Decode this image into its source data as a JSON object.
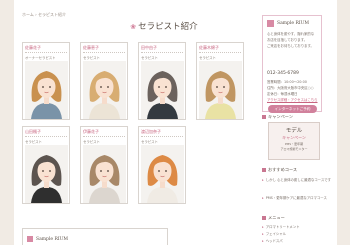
{
  "breadcrumb": "ホーム › セラピスト紹介",
  "page_title": "セラピスト紹介",
  "therapists": [
    {
      "name": "佐藤花子",
      "role": "オーナーセラピスト"
    },
    {
      "name": "佐藤恵子",
      "role": "セラピスト"
    },
    {
      "name": "田中由子",
      "role": "セラピスト"
    },
    {
      "name": "佐藤木綿子",
      "role": "セラピスト"
    },
    {
      "name": "山田楓子",
      "role": "セラピスト"
    },
    {
      "name": "伊藤花子",
      "role": "セラピスト"
    },
    {
      "name": "渡辺加奈子",
      "role": "セラピスト"
    }
  ],
  "sidebar": {
    "salon_name": "Sample RIUM",
    "lines": [
      "心と身体を癒やす、隠れ家的な",
      "お店を目指しております。",
      "ご来店をお待ちしております。"
    ],
    "tel": "012-345-6789",
    "info": [
      "営業時間：10:00〜20:00",
      "住所：大阪府大阪市中央区○○",
      "定休日：毎週水曜日",
      "アクセス詳細・アクセスはこちら"
    ],
    "reserve_button": "インターネットご予約",
    "campaign_heading": "キャンペーン",
    "model_banner": {
      "title": "モデル",
      "subtitle": "キャンペーン",
      "line1": "PMS・更年期",
      "line2": "アロマ施術モニター"
    },
    "course_heading": "おすすめコース",
    "courses": [
      "しかし 心と身体の癒しに最適なコースです",
      "PMS・更年期ケアに最適なアロマコース"
    ],
    "menu_heading": "メニュー",
    "menu": [
      "アロマトリートメント",
      "フェイシャル",
      "ヘッドスパ"
    ]
  },
  "footer": {
    "salon_name": "Sample RIUM"
  },
  "colors": {
    "accent": "#d1819c",
    "page_bg": "#f1ebe4"
  }
}
